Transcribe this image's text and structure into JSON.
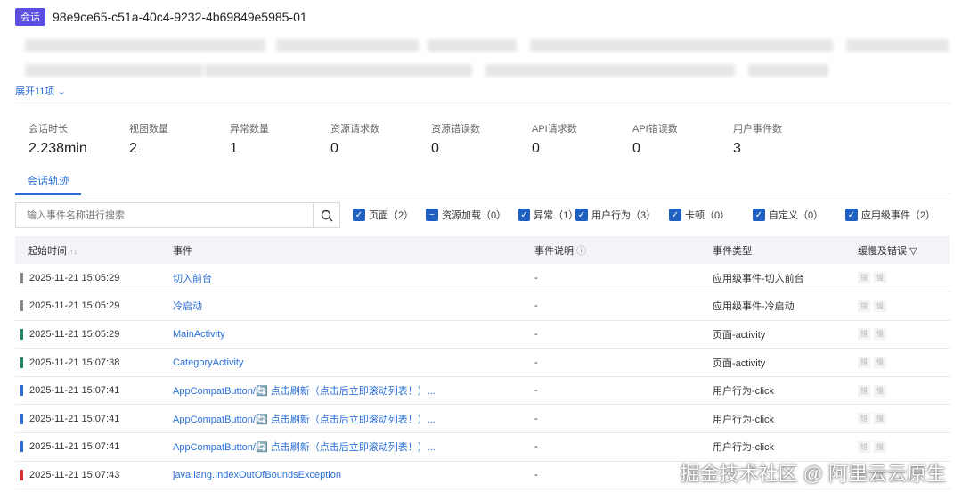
{
  "header": {
    "badge": "会话",
    "session_id": "98e9ce65-c51a-40c4-9232-4b69849e5985-01"
  },
  "expand_label": "展开11项",
  "stats": [
    {
      "label": "会话时长",
      "value": "2.238min"
    },
    {
      "label": "视图数量",
      "value": "2"
    },
    {
      "label": "异常数量",
      "value": "1"
    },
    {
      "label": "资源请求数",
      "value": "0"
    },
    {
      "label": "资源错误数",
      "value": "0"
    },
    {
      "label": "API请求数",
      "value": "0"
    },
    {
      "label": "API错误数",
      "value": "0"
    },
    {
      "label": "用户事件数",
      "value": "3"
    }
  ],
  "tab": "会话轨迹",
  "search": {
    "placeholder": "输入事件名称进行搜索"
  },
  "filters": [
    {
      "label": "页面（2）",
      "state": "checked"
    },
    {
      "label": "资源加载（0）",
      "state": "indeterminate"
    },
    {
      "label": "异常（1）",
      "state": "checked"
    },
    {
      "label": "用户行为（3）",
      "state": "checked"
    },
    {
      "label": "卡顿（0）",
      "state": "checked"
    },
    {
      "label": "自定义（0）",
      "state": "checked"
    },
    {
      "label": "应用级事件（2）",
      "state": "checked"
    }
  ],
  "columns": {
    "time": "起始时间",
    "event": "事件",
    "desc": "事件说明",
    "type": "事件类型",
    "slow": "缓慢及错误"
  },
  "tags": {
    "error": "错",
    "slow": "慢"
  },
  "rows": [
    {
      "time": "2025-11-21 15:05:29",
      "event": "切入前台",
      "desc": "-",
      "type": "应用级事件-切入前台",
      "color": "#888888"
    },
    {
      "time": "2025-11-21 15:05:29",
      "event": "冷启动",
      "desc": "-",
      "type": "应用级事件-冷启动",
      "color": "#888888"
    },
    {
      "time": "2025-11-21 15:05:29",
      "event": "MainActivity",
      "desc": "-",
      "type": "页面-activity",
      "color": "#1a8a6a"
    },
    {
      "time": "2025-11-21 15:07:38",
      "event": "CategoryActivity",
      "desc": "-",
      "type": "页面-activity",
      "color": "#1a8a6a"
    },
    {
      "time": "2025-11-21 15:07:41",
      "event": "AppCompatButton/🔄 点击刷新（点击后立即滚动列表！）...",
      "desc": "-",
      "type": "用户行为-click",
      "color": "#2a6fd6"
    },
    {
      "time": "2025-11-21 15:07:41",
      "event": "AppCompatButton/🔄 点击刷新（点击后立即滚动列表！）...",
      "desc": "-",
      "type": "用户行为-click",
      "color": "#2a6fd6"
    },
    {
      "time": "2025-11-21 15:07:41",
      "event": "AppCompatButton/🔄 点击刷新（点击后立即滚动列表！）...",
      "desc": "-",
      "type": "用户行为-click",
      "color": "#2a6fd6"
    },
    {
      "time": "2025-11-21 15:07:43",
      "event": "java.lang.IndexOutOfBoundsException",
      "desc": "-",
      "type": "",
      "color": "#d93030"
    }
  ],
  "watermark": "掘金技术社区 @ 阿里云云原生"
}
